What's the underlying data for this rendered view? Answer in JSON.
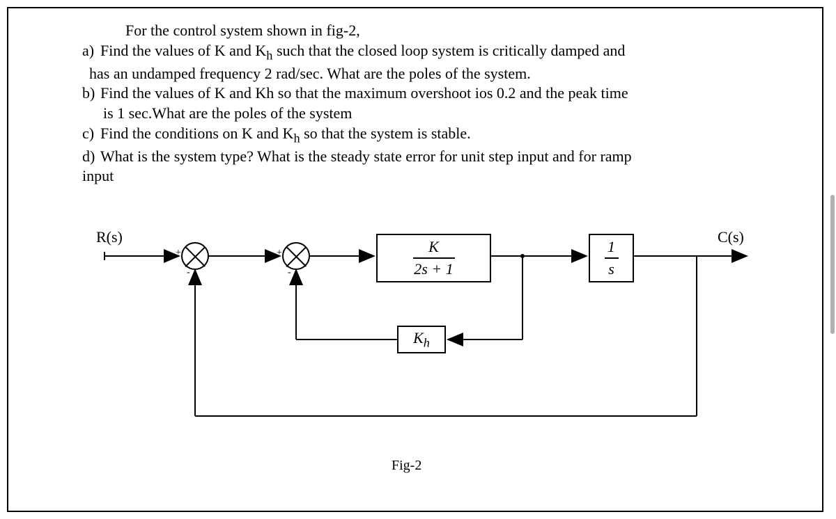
{
  "question": {
    "intro": "For the control system shown in fig-2,",
    "a": {
      "label": "a)",
      "text": "Find the values of K and K",
      "sub": "h",
      "after": " such that the closed loop system is critically damped and",
      "line2": "has an undamped frequency 2 rad/sec. What are the poles of the system."
    },
    "b": {
      "label": "b)",
      "text": "Find the values of K and Kh so that the maximum overshoot ios 0.2 and the peak time",
      "line2": "is 1 sec.What are the poles of the system"
    },
    "c": {
      "label": "c)",
      "text": "Find the conditions on K and K",
      "sub": "h",
      "after": " so that the system is stable."
    },
    "d": {
      "label": "d)",
      "text": "What is the system type? What is the steady state error for unit step input and for ramp",
      "line2": "input"
    }
  },
  "diagram": {
    "input": "R(s)",
    "output": "C(s)",
    "block1_num": "K",
    "block1_den": "2s + 1",
    "block2_num": "1",
    "block2_den": "s",
    "feedback_block": "K",
    "feedback_sub": "h",
    "caption": "Fig-2"
  }
}
